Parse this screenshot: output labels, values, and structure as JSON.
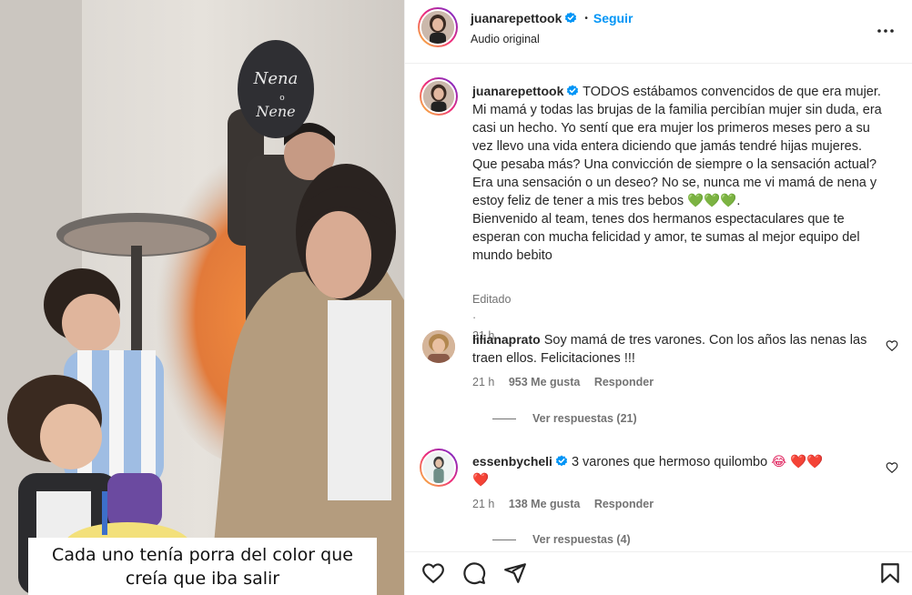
{
  "media": {
    "balloon_text_1": "Nena",
    "balloon_text_2": "o",
    "balloon_text_3": "Nene",
    "caption_line1": "Cada uno tenía porra del color que",
    "caption_line2": "creía que iba salir"
  },
  "header": {
    "username": "juanarepettook",
    "separator": "•",
    "follow_label": "Seguir",
    "audio_label": "Audio original",
    "more_icon": "more-horizontal-icon"
  },
  "post_caption": {
    "username": "juanarepettook",
    "text": "TODOS estábamos convencidos de que era mujer. Mi mamá y todas las brujas de la familia percibían mujer sin duda, era casi un hecho. Yo sentí que era mujer los primeros meses pero a su vez llevo una vida entera diciendo que jamás tendré hijas mujeres. Que pesaba más? Una convicción de siempre o la sensación actual? Era una sensación o un deseo? No se, nunca me vi mamá de nena y estoy feliz de tener a mis tres bebos",
    "hearts": "💚💚💚",
    "text_end": ".",
    "text2": "Bienvenido al team, tenes dos hermanos espectaculares que te esperan con mucha felicidad y amor, te sumas al mejor equipo del mundo bebito",
    "edited_label": "Editado",
    "edited_sep": "·",
    "edited_time": "21 h"
  },
  "comments": [
    {
      "username": "lilianaprato",
      "text": "Soy mamá de tres varones. Con los años las nenas las traen ellos. Felicitaciones !!!",
      "time": "21 h",
      "likes": "953 Me gusta",
      "reply_label": "Responder",
      "view_replies": "Ver respuestas (21)"
    },
    {
      "username": "essenbycheli",
      "text": "3 varones que hermoso quilombo",
      "emoji": "😂 ❤️❤️",
      "emoji2": "❤️",
      "time": "21 h",
      "likes": "138 Me gusta",
      "reply_label": "Responder",
      "view_replies": "Ver respuestas (4)"
    }
  ],
  "actions": {
    "like_icon": "heart-icon",
    "comment_icon": "comment-icon",
    "share_icon": "send-icon",
    "save_icon": "bookmark-icon"
  },
  "colors": {
    "follow": "#0095f6",
    "verified": "#0095f6",
    "text": "#262626",
    "secondary": "#737373"
  }
}
